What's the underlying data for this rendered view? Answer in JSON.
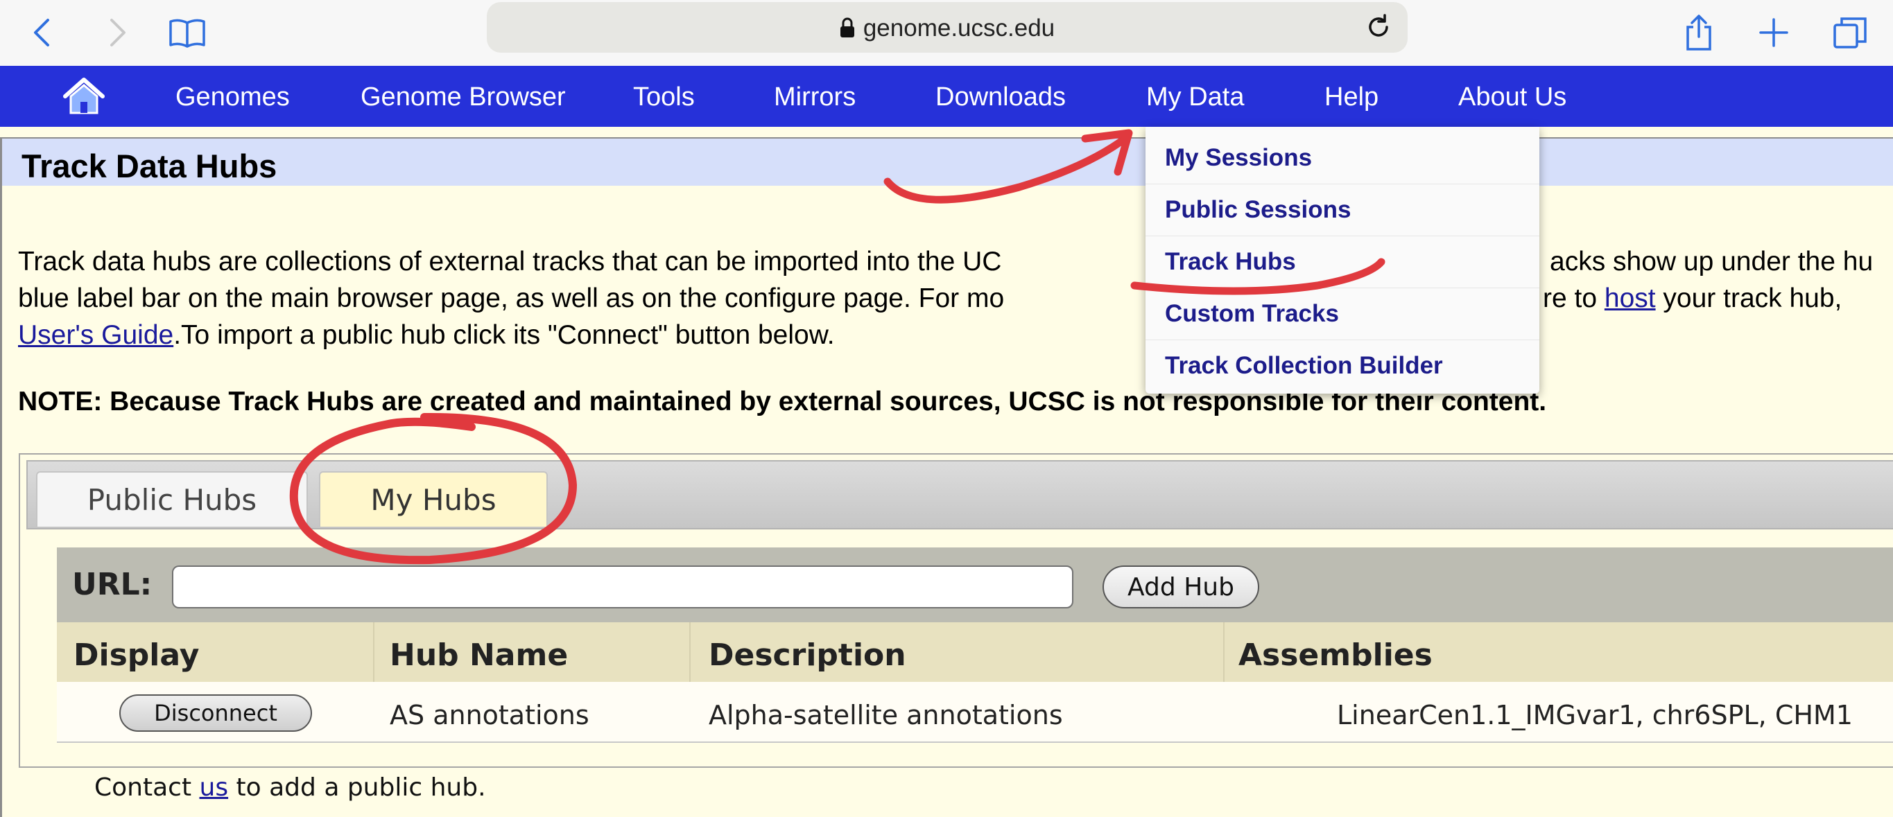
{
  "browser": {
    "domain": "genome.ucsc.edu",
    "icons": [
      "back-icon",
      "forward-icon",
      "bookmarks-icon",
      "lock-icon",
      "reload-icon",
      "share-icon",
      "new-tab-icon",
      "tabs-icon"
    ]
  },
  "site_nav": {
    "items": [
      "Genomes",
      "Genome Browser",
      "Tools",
      "Mirrors",
      "Downloads",
      "My Data",
      "Help",
      "About Us"
    ]
  },
  "dropdown": {
    "items": [
      "My Sessions",
      "Public Sessions",
      "Track Hubs",
      "Custom Tracks",
      "Track Collection Builder"
    ]
  },
  "page": {
    "title": "Track Data Hubs",
    "intro_line1": "Track data hubs are collections of external tracks that can be imported into the UC",
    "intro_line1_tail": "acks show up under the hu",
    "intro_line2_start": "blue label bar on the main browser page, as well as on the configure page. For mo",
    "intro_line2_mid": "re to ",
    "intro_line2_link": "host",
    "intro_line2_end": " your track hub,",
    "intro_line3_link": "User's Guide",
    "intro_line3_end": ".To import a public hub click its \"Connect\" button below.",
    "note": "NOTE: Because Track Hubs are created and maintained by external sources, UCSC is not responsible for their content."
  },
  "tabs": [
    "Public Hubs",
    "My Hubs"
  ],
  "hub_form": {
    "url_label": "URL:",
    "url_value": "",
    "add_button": "Add Hub"
  },
  "table": {
    "headers": [
      "Display",
      "Hub Name",
      "Description",
      "Assemblies"
    ],
    "rows": [
      {
        "button": "Disconnect",
        "hub_name": "AS annotations",
        "description": "Alpha-satellite annotations",
        "assemblies": "LinearCen1.1_IMGvar1, chr6SPL, CHM1"
      }
    ]
  },
  "contact": {
    "prefix": "Contact ",
    "link": "us",
    "suffix": " to add a public hub."
  },
  "colors": {
    "nav_blue": "#2631d9",
    "menu_text": "#1c1c8a",
    "annotation_red": "#e0393e",
    "page_bg": "#fffde6"
  }
}
